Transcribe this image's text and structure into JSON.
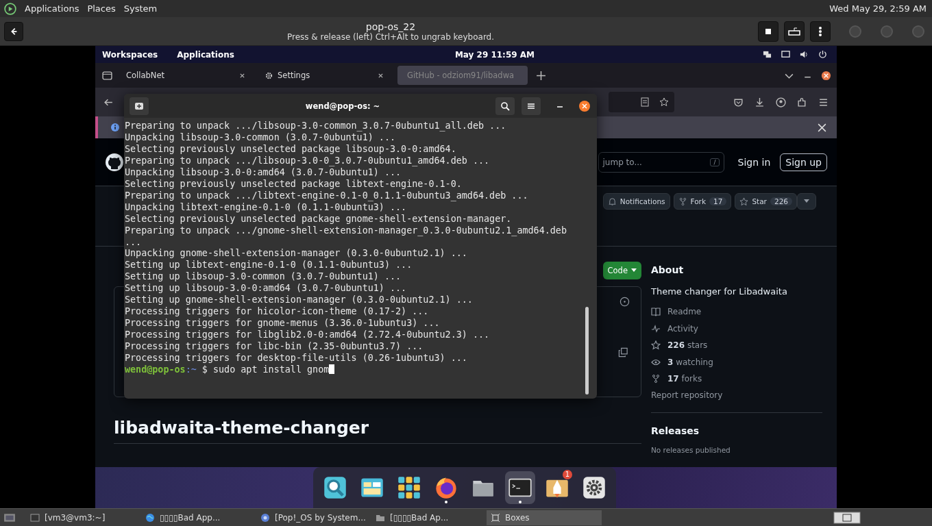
{
  "host_panel": {
    "menus": [
      "Applications",
      "Places",
      "System"
    ],
    "clock": "Wed May 29, 2:59 AM"
  },
  "boxes_header": {
    "title": "pop-os_22",
    "subtitle": "Press & release (left) Ctrl+Alt to ungrab keyboard."
  },
  "vm_top_bar": {
    "items": [
      "Workspaces",
      "Applications"
    ],
    "clock": "May 29  11:59 AM"
  },
  "browser": {
    "tabs": [
      {
        "label": "CollabNet",
        "kind": "plain",
        "selected": false
      },
      {
        "label": "Settings",
        "kind": "gear",
        "selected": false
      },
      {
        "label": "GitHub - odziom91/libadwa",
        "kind": "github",
        "selected": true
      }
    ]
  },
  "github": {
    "search_placeholder": "jump to...",
    "shortcut": "/",
    "sign_in": "Sign in",
    "sign_up": "Sign up",
    "repo_buttons": [
      {
        "kind": "bell",
        "label": "Notifications"
      },
      {
        "kind": "fork",
        "label": "Fork",
        "count": "17"
      },
      {
        "kind": "star",
        "label": "Star",
        "count": "226"
      }
    ],
    "code_button": "Code",
    "repo_title": "libadwaita-theme-changer",
    "about": {
      "title": "About",
      "description": "Theme changer for Libadwaita",
      "links": [
        {
          "kind": "readme",
          "text": "Readme"
        },
        {
          "kind": "activity",
          "text": "Activity"
        },
        {
          "kind": "star",
          "text": "**226** stars"
        },
        {
          "kind": "eye",
          "text": "**3** watching"
        },
        {
          "kind": "fork",
          "text": "**17** forks"
        }
      ],
      "report": "Report repository"
    },
    "releases": {
      "title": "Releases",
      "note": "No releases published"
    }
  },
  "terminal": {
    "title": "wend@pop-os: ~",
    "lines": [
      "Preparing to unpack .../libsoup-3.0-common_3.0.7-0ubuntu1_all.deb ...",
      "Unpacking libsoup-3.0-common (3.0.7-0ubuntu1) ...",
      "Selecting previously unselected package libsoup-3.0-0:amd64.",
      "Preparing to unpack .../libsoup-3.0-0_3.0.7-0ubuntu1_amd64.deb ...",
      "Unpacking libsoup-3.0-0:amd64 (3.0.7-0ubuntu1) ...",
      "Selecting previously unselected package libtext-engine-0.1-0.",
      "Preparing to unpack .../libtext-engine-0.1-0_0.1.1-0ubuntu3_amd64.deb ...",
      "Unpacking libtext-engine-0.1-0 (0.1.1-0ubuntu3) ...",
      "Selecting previously unselected package gnome-shell-extension-manager.",
      "Preparing to unpack .../gnome-shell-extension-manager_0.3.0-0ubuntu2.1_amd64.deb ...",
      "Unpacking gnome-shell-extension-manager (0.3.0-0ubuntu2.1) ...",
      "Setting up libtext-engine-0.1-0 (0.1.1-0ubuntu3) ...",
      "Setting up libsoup-3.0-common (3.0.7-0ubuntu1) ...",
      "Setting up libsoup-3.0-0:amd64 (3.0.7-0ubuntu1) ...",
      "Setting up gnome-shell-extension-manager (0.3.0-0ubuntu2.1) ...",
      "Processing triggers for hicolor-icon-theme (0.17-2) ...",
      "Processing triggers for gnome-menus (3.36.0-1ubuntu3) ...",
      "Processing triggers for libglib2.0-0:amd64 (2.72.4-0ubuntu2.3) ...",
      "Processing triggers for libc-bin (2.35-0ubuntu3.7) ...",
      "Processing triggers for desktop-file-utils (0.26-1ubuntu3) ..."
    ],
    "prompt_user": "wend@pop-os",
    "prompt_path": ":~",
    "command": "$ sudo apt install gnom"
  },
  "dock": [
    {
      "kind": "search",
      "running": false,
      "selected": false
    },
    {
      "kind": "windows",
      "running": false,
      "selected": false
    },
    {
      "kind": "apps",
      "running": false,
      "selected": false
    },
    {
      "kind": "firefox",
      "running": true,
      "selected": false
    },
    {
      "kind": "files",
      "running": false,
      "selected": false
    },
    {
      "kind": "terminal",
      "running": true,
      "selected": true
    },
    {
      "kind": "launcher",
      "running": false,
      "selected": false,
      "badge": "1"
    },
    {
      "kind": "settings",
      "running": false,
      "selected": false
    }
  ],
  "host_taskbar": [
    {
      "kind": "terminal",
      "label": "[vm3@vm3:~]",
      "selected": false
    },
    {
      "kind": "globe",
      "label": "▯▯▯▯Bad App...",
      "selected": false
    },
    {
      "kind": "browser",
      "label": "[Pop!_OS by System...",
      "selected": false
    },
    {
      "kind": "folder",
      "label": "[▯▯▯▯Bad Ap...",
      "selected": false
    },
    {
      "kind": "boxes",
      "label": "Boxes",
      "selected": true
    }
  ]
}
